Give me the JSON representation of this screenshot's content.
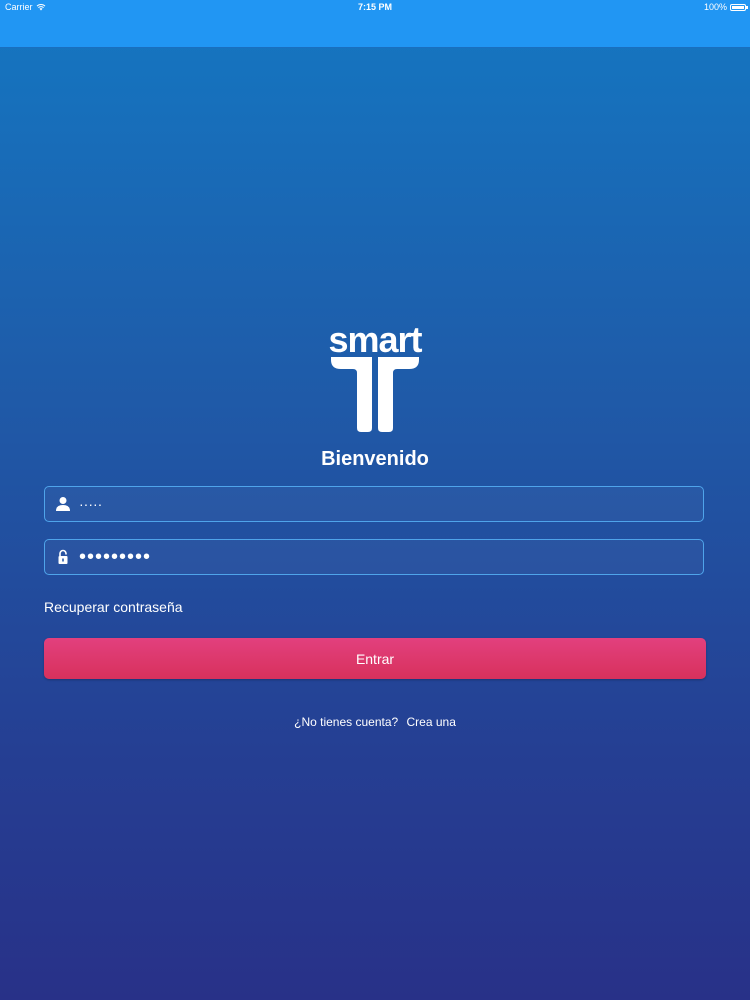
{
  "status_bar": {
    "carrier": "Carrier",
    "time": "7:15 PM",
    "battery": "100%"
  },
  "logo": {
    "text": "smart",
    "color": "#ffffff"
  },
  "welcome": "Bienvenido",
  "form": {
    "username_value": "·····",
    "password_value": "•••••••••",
    "recover_link": "Recuperar contraseña",
    "submit_label": "Entrar"
  },
  "signup": {
    "question": "¿No tienes cuenta?",
    "link": "Crea una"
  },
  "colors": {
    "navbar": "#2196f3",
    "button": "#dc3868",
    "field_border": "#4fa4ea"
  }
}
